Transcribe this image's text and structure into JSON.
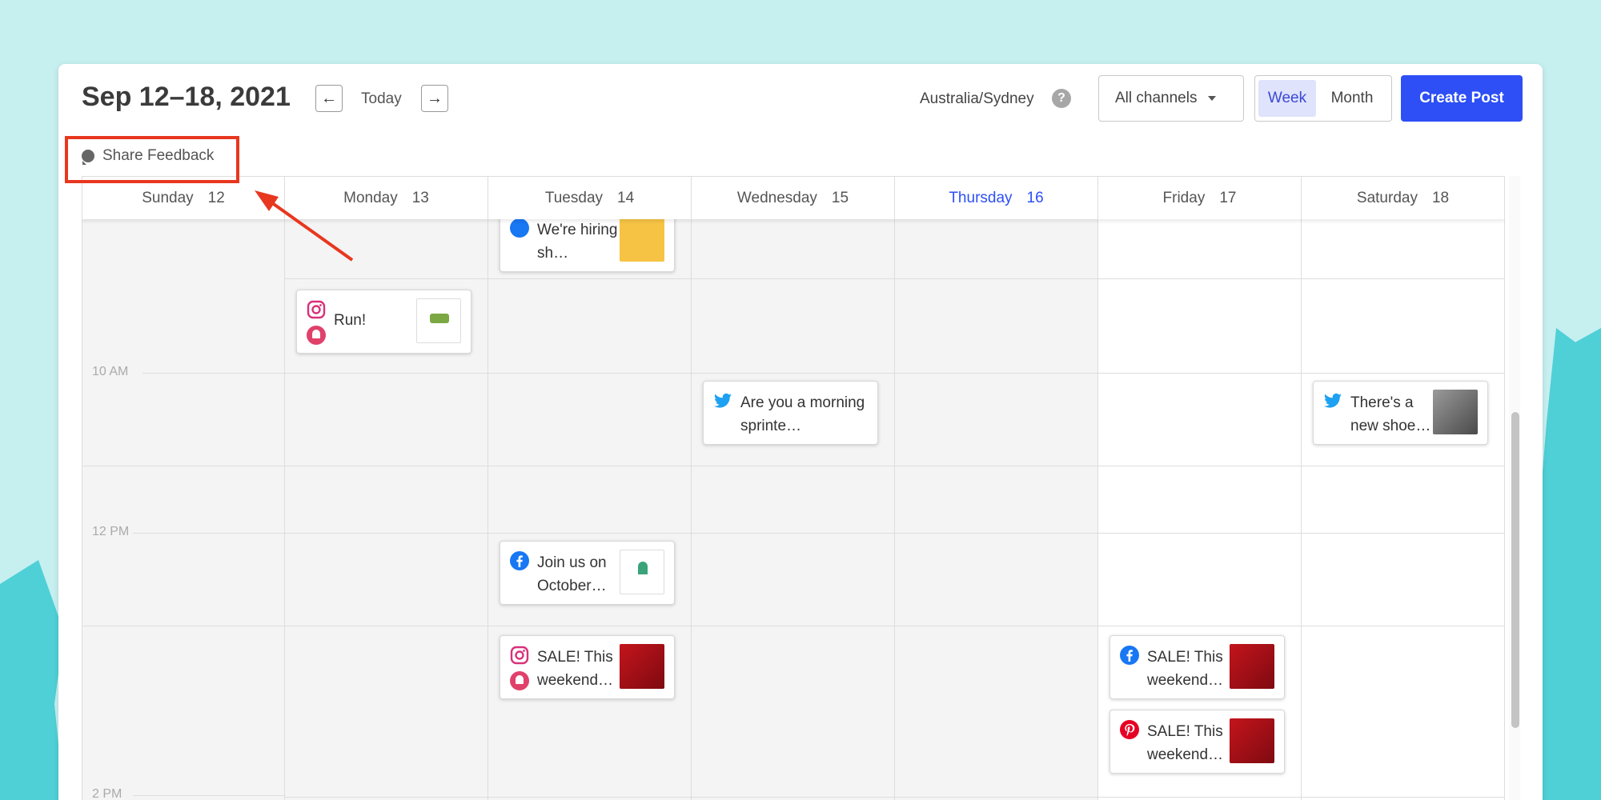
{
  "header": {
    "title": "Sep 12–18, 2021",
    "prev_label": "←",
    "today_label": "Today",
    "next_label": "→",
    "timezone": "Australia/Sydney",
    "help_label": "?",
    "channels_label": "All channels",
    "view_week": "Week",
    "view_month": "Month",
    "create_post": "Create Post",
    "feedback_label": "Share Feedback"
  },
  "days": [
    {
      "name": "Sunday",
      "num": "12"
    },
    {
      "name": "Monday",
      "num": "13"
    },
    {
      "name": "Tuesday",
      "num": "14"
    },
    {
      "name": "Wednesday",
      "num": "15"
    },
    {
      "name": "Thursday",
      "num": "16"
    },
    {
      "name": "Friday",
      "num": "17"
    },
    {
      "name": "Saturday",
      "num": "18"
    }
  ],
  "times": [
    "10 AM",
    "12 PM",
    "2 PM"
  ],
  "posts": [
    {
      "day": "Tuesday",
      "text": "We're hiring sh…",
      "channel": "facebook-icon",
      "thumb": "yellow"
    },
    {
      "day": "Monday",
      "text": "Run!",
      "channel": "instagram-icon",
      "reminder": true,
      "thumb": "white"
    },
    {
      "day": "Wednesday",
      "text": "Are you a morning sprinte…",
      "channel": "twitter-icon"
    },
    {
      "day": "Saturday",
      "text": "There's a new shoe…",
      "channel": "twitter-icon",
      "thumb": "grey"
    },
    {
      "day": "Tuesday",
      "text": "Join us on October…",
      "channel": "facebook-icon",
      "thumb": "white"
    },
    {
      "day": "Tuesday",
      "text": "SALE! This weekend…",
      "channel": "instagram-icon",
      "reminder": true,
      "thumb": "red"
    },
    {
      "day": "Friday",
      "text": "SALE! This weekend…",
      "channel": "facebook-icon",
      "thumb": "red"
    },
    {
      "day": "Friday",
      "text": "SALE! This weekend…",
      "channel": "pinterest-icon",
      "thumb": "red"
    }
  ],
  "colors": {
    "accent": "#2d4ff5",
    "annotation": "#e8371f",
    "instagram": "#d9317a",
    "twitter": "#1da1f2",
    "facebook": "#1877f2",
    "pinterest": "#e60023"
  }
}
